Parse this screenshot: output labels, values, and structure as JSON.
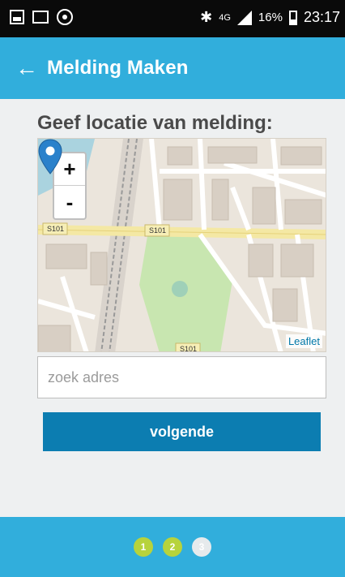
{
  "status_bar": {
    "network": "4G",
    "battery_pct": "16%",
    "time": "23:17",
    "icons": [
      "gallery-icon",
      "mail-icon",
      "target-icon",
      "bluetooth-icon",
      "signal-icon",
      "battery-icon"
    ]
  },
  "app_bar": {
    "back_icon": "arrow-left-icon",
    "back_glyph": "←",
    "title": "Melding Maken"
  },
  "main": {
    "heading": "Geef locatie van melding:",
    "map": {
      "zoom_in": "+",
      "zoom_out": "-",
      "attribution": "Leaflet",
      "road_labels": [
        "S101",
        "S101",
        "S101"
      ],
      "marker_icon": "location-pin-icon"
    },
    "search": {
      "value": "",
      "placeholder": "zoek adres"
    },
    "next_button": "volgende"
  },
  "footer": {
    "steps": [
      {
        "label": "1",
        "state": "done"
      },
      {
        "label": "2",
        "state": "done"
      },
      {
        "label": "3",
        "state": "todo"
      }
    ]
  },
  "colors": {
    "app_bar": "#31aedc",
    "button": "#0c7db1",
    "step_done": "#b7d33c",
    "step_todo": "#e6eaec"
  }
}
